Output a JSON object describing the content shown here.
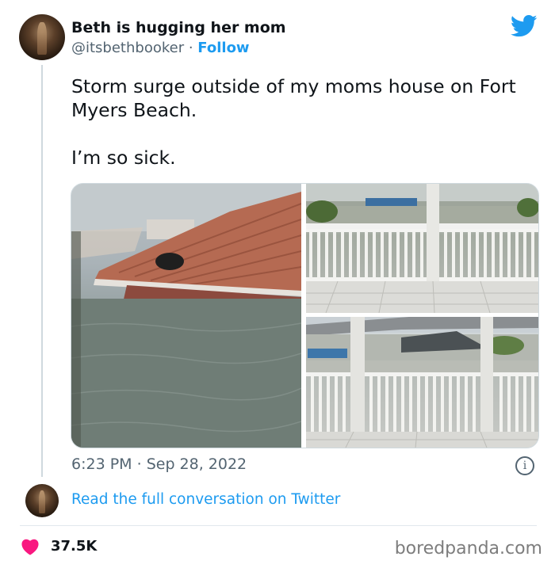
{
  "tweet": {
    "author_name": "Beth is hugging her mom",
    "author_handle": "@itsbethbooker",
    "handle_separator": " · ",
    "follow_label": "Follow",
    "text_line1": "Storm surge outside of my moms house on Fort Myers Beach.",
    "text_line2": "I’m so sick.",
    "time": "6:23 PM",
    "date_separator": " · ",
    "date": "Sep 28, 2022",
    "info_glyph": "i",
    "read_more": "Read the full conversation on Twitter",
    "likes": "37.5K"
  },
  "watermark": "boredpanda.com",
  "colors": {
    "accent": "#1d9bf0",
    "heart": "#f91880",
    "secondary_text": "#536471"
  },
  "icons": [
    "twitter-bird-icon",
    "info-icon",
    "heart-icon"
  ]
}
